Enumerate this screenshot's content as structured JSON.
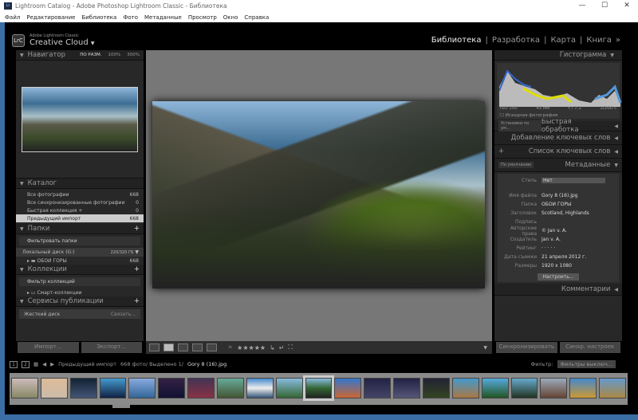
{
  "window": {
    "title": "Lightroom Catalog - Adobe Photoshop Lightroom Classic - Библиотека",
    "controls": [
      "—",
      "☐",
      "✕"
    ]
  },
  "menu": [
    "Файл",
    "Редактирование",
    "Библиотека",
    "Фото",
    "Метаданные",
    "Просмотр",
    "Окно",
    "Справка"
  ],
  "identity": {
    "logo": "LrC",
    "product": "Adobe Lightroom Classic",
    "name": "Creative Cloud"
  },
  "modules": [
    "Библиотека",
    "Разработка",
    "Карта",
    "Книга"
  ],
  "navigator": {
    "title": "Навигатор",
    "zoom": [
      "ПО РАЗМ.",
      "100%",
      "300%"
    ]
  },
  "catalog": {
    "title": "Каталог",
    "items": [
      {
        "label": "Все фотографии",
        "count": "668"
      },
      {
        "label": "Все синхронизированные фотографии",
        "count": "0"
      },
      {
        "label": "Быстрая коллекция +",
        "count": "0"
      },
      {
        "label": "Предыдущий импорт",
        "count": "668"
      }
    ]
  },
  "folders": {
    "title": "Папки",
    "filter": "Фильтровать папки",
    "disk": "Локальный диск (G:)",
    "disk_space": "220/320 ГБ",
    "folder": "ОБОИ ГОРЫ",
    "folder_count": "668"
  },
  "collections": {
    "title": "Коллекции",
    "filter": "Фильтр коллекций",
    "smart": "Смарт-коллекции"
  },
  "publish": {
    "title": "Сервисы публикации",
    "hd": "Жесткий диск",
    "setup": "Связать..."
  },
  "buttons": {
    "import": "Импорт...",
    "export": "Экспорт...",
    "sync": "Синхронизировать",
    "sync_settings": "Синхр. настроек"
  },
  "histogram": {
    "title": "Гистограмма",
    "iso": "ISO 100",
    "focal": "45 мм",
    "aperture": "f / 7,1",
    "shutter": "1/200 с",
    "original": "Исходная фотография"
  },
  "quick": {
    "preset": "Установки по ум...",
    "title": "Быстрая обработка"
  },
  "keywording": "Добавление ключевых слов",
  "keyword_list": "Список ключевых слов",
  "metadata": {
    "preset": "По умолчанию",
    "title": "Метаданные",
    "style_label": "Стиль",
    "style_value": "Нет",
    "fields": [
      {
        "k": "Имя файла",
        "v": "Gory 8 (16).jpg"
      },
      {
        "k": "Папка",
        "v": "ОБОИ ГОРЫ"
      },
      {
        "k": "Заголовок",
        "v": "Scotland, Highlands"
      },
      {
        "k": "Подпись",
        "v": ""
      },
      {
        "k": "Авторские права",
        "v": "© Jan v. A."
      },
      {
        "k": "Создатель",
        "v": "Jan v. A."
      },
      {
        "k": "Рейтинг",
        "v": "· · · · ·"
      },
      {
        "k": "Дата съемки",
        "v": "21 апреля 2012 г."
      },
      {
        "k": "Размеры",
        "v": "1920 x 1080"
      }
    ],
    "customize": "Настроить..."
  },
  "comments": "Комментарии",
  "toolbar": {
    "stars": "★★★★★"
  },
  "filmstrip": {
    "source": "Предыдущий импорт",
    "count": "668 фото/ Выделено 1/",
    "file": "Gory 8 (16).jpg",
    "filter_label": "Фильтр:",
    "filter_value": "Фильтры выключ...",
    "pages": [
      "1",
      "2"
    ]
  }
}
